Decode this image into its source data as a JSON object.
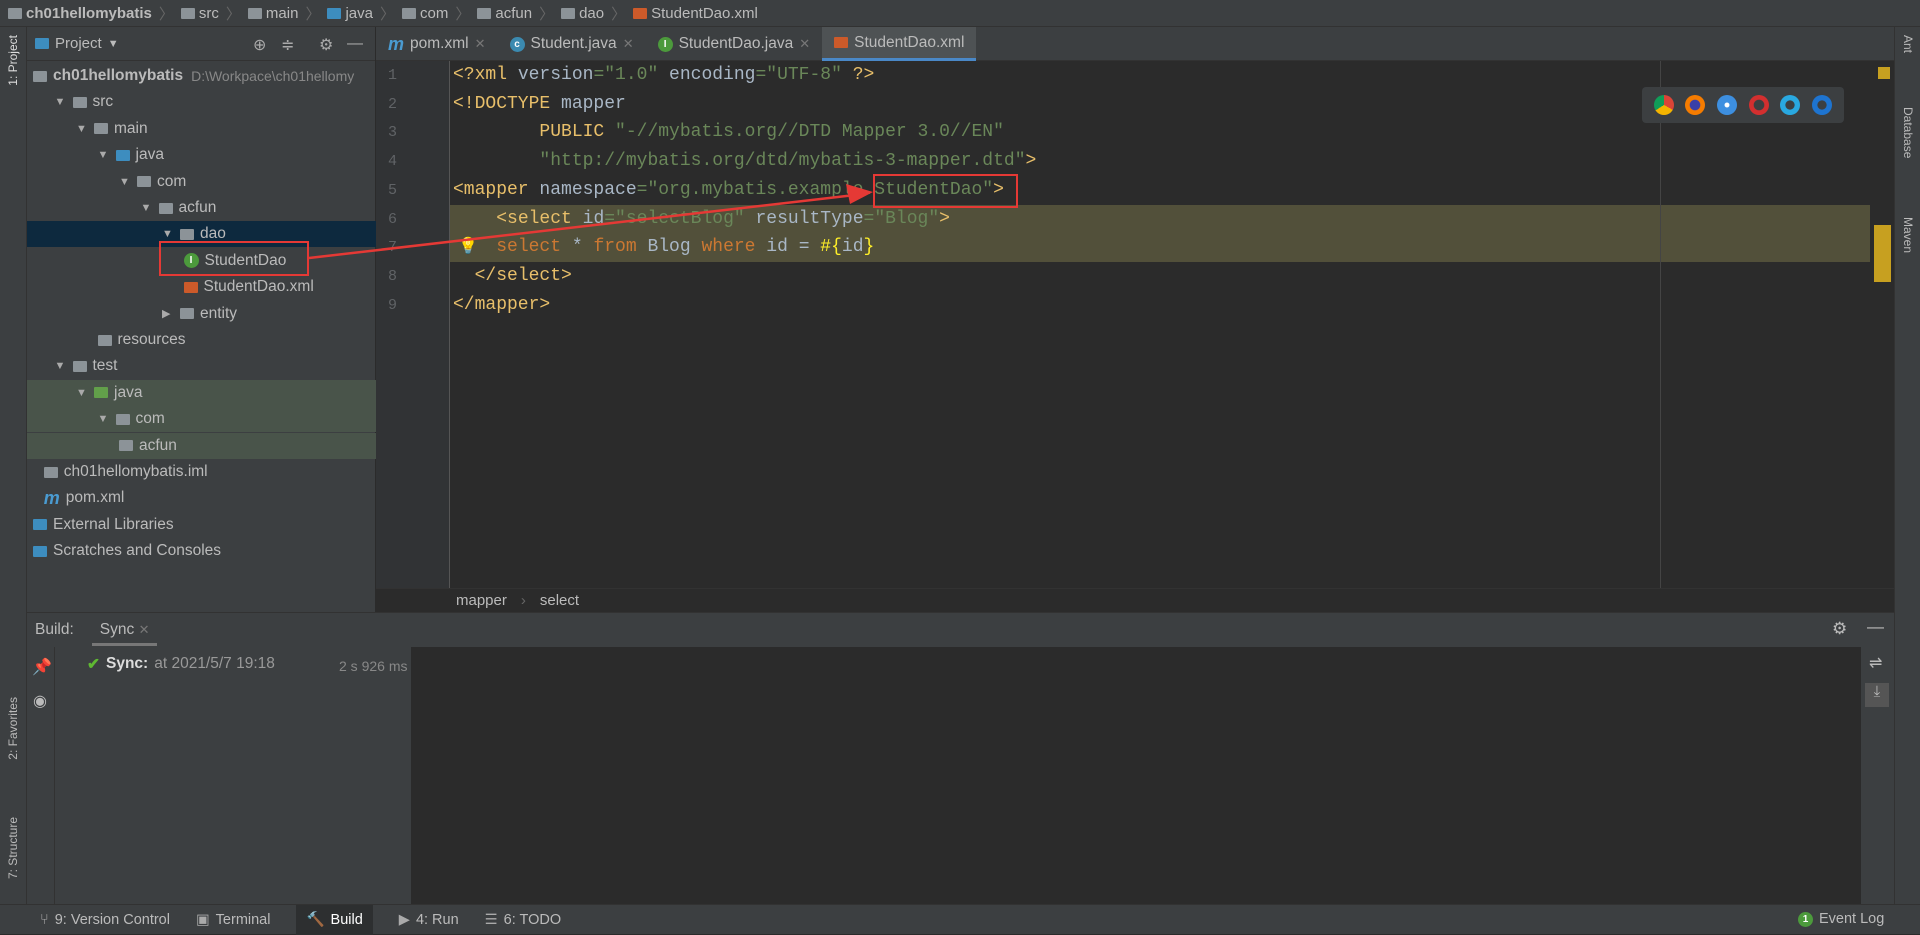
{
  "nav": {
    "crumbs": [
      "ch01hellomybatis",
      "src",
      "main",
      "java",
      "com",
      "acfun",
      "dao",
      "StudentDao.xml"
    ]
  },
  "left_strip": {
    "project": "1: Project",
    "favorites": "2: Favorites",
    "structure": "7: Structure"
  },
  "right_strip": {
    "ant": "Ant",
    "database": "Database",
    "maven": "Maven"
  },
  "project": {
    "title": "Project",
    "tree": [
      {
        "label": "ch01hellomybatis",
        "path": "D:\\Workpace\\ch01hellomy",
        "level": 0,
        "arrow": "",
        "icon": "module"
      },
      {
        "label": "src",
        "level": 1,
        "arrow": "▼",
        "icon": "folder"
      },
      {
        "label": "main",
        "level": 2,
        "arrow": "▼",
        "icon": "folder"
      },
      {
        "label": "java",
        "level": 3,
        "arrow": "▼",
        "icon": "folder-blue"
      },
      {
        "label": "com",
        "level": 4,
        "arrow": "▼",
        "icon": "package"
      },
      {
        "label": "acfun",
        "level": 5,
        "arrow": "▼",
        "icon": "package"
      },
      {
        "label": "dao",
        "level": 6,
        "arrow": "▼",
        "icon": "package",
        "selected": true
      },
      {
        "label": "StudentDao",
        "level": 7,
        "arrow": "",
        "icon": "interface"
      },
      {
        "label": "StudentDao.xml",
        "level": 7,
        "arrow": "",
        "icon": "xml"
      },
      {
        "label": "entity",
        "level": 6,
        "arrow": "▶",
        "icon": "package"
      },
      {
        "label": "resources",
        "level": 3,
        "arrow": "",
        "icon": "resources"
      },
      {
        "label": "test",
        "level": 1,
        "arrow": "▼",
        "icon": "folder"
      },
      {
        "label": "java",
        "level": 2,
        "arrow": "▼",
        "icon": "folder-green",
        "test": true
      },
      {
        "label": "com",
        "level": 3,
        "arrow": "▼",
        "icon": "package",
        "test": true
      },
      {
        "label": "acfun",
        "level": 4,
        "arrow": "",
        "icon": "package",
        "test": true
      },
      {
        "label": "ch01hellomybatis.iml",
        "level": 0.5,
        "arrow": "",
        "icon": "iml"
      },
      {
        "label": "pom.xml",
        "level": 0.5,
        "arrow": "",
        "icon": "maven"
      },
      {
        "label": "External Libraries",
        "level": 0,
        "arrow": "",
        "icon": "libraries"
      },
      {
        "label": "Scratches and Consoles",
        "level": 0,
        "arrow": "",
        "icon": "scratches"
      }
    ]
  },
  "tabs": [
    {
      "label": "pom.xml",
      "icon": "maven",
      "active": false
    },
    {
      "label": "Student.java",
      "icon": "class",
      "active": false
    },
    {
      "label": "StudentDao.java",
      "icon": "interface",
      "active": false
    },
    {
      "label": "StudentDao.xml",
      "icon": "xml",
      "active": true
    }
  ],
  "editor": {
    "line_numbers": [
      "1",
      "2",
      "3",
      "4",
      "5",
      "6",
      "7",
      "8",
      "9"
    ],
    "lines": [
      [
        [
          "t",
          "<?xml "
        ],
        [
          "",
          "version"
        ],
        [
          "s",
          "=\"1.0\""
        ],
        [
          "",
          " encoding"
        ],
        [
          "s",
          "=\"UTF-8\""
        ],
        [
          "t",
          " ?>"
        ]
      ],
      [
        [
          "t",
          "<!DOCTYPE "
        ],
        [
          "",
          "mapper"
        ]
      ],
      [
        [
          "",
          "        "
        ],
        [
          "t",
          "PUBLIC "
        ],
        [
          "s",
          "\"-//mybatis.org//DTD Mapper 3.0//EN\""
        ]
      ],
      [
        [
          "",
          "        "
        ],
        [
          "s",
          "\"http://mybatis.org/dtd/mybatis-3-mapper.dtd\""
        ],
        [
          "t",
          ">"
        ]
      ],
      [
        [
          "t",
          "<mapper "
        ],
        [
          "",
          "namespace"
        ],
        [
          "s",
          "=\"org.mybatis.example.StudentDao\""
        ],
        [
          "t",
          ">"
        ]
      ],
      [
        [
          "",
          "    "
        ],
        [
          "t",
          "<select "
        ],
        [
          "",
          "id"
        ],
        [
          "s",
          "=\"selectBlog\""
        ],
        [
          "",
          " resultType"
        ],
        [
          "s",
          "=\"Blog\""
        ],
        [
          "t",
          ">"
        ]
      ],
      [
        [
          "",
          "    "
        ],
        [
          "k",
          "select"
        ],
        [
          "",
          " * "
        ],
        [
          "k",
          "from"
        ],
        [
          "",
          " Blog "
        ],
        [
          "k",
          "where"
        ],
        [
          "",
          " id = "
        ],
        [
          "y",
          "#{"
        ],
        [
          "",
          "id"
        ],
        [
          "y",
          "}"
        ]
      ],
      [
        [
          "",
          "  "
        ],
        [
          "t",
          "</select>"
        ]
      ],
      [
        [
          "t",
          "</mapper>"
        ]
      ]
    ],
    "breadcrumb": [
      "mapper",
      "select"
    ],
    "browsers": [
      "chrome",
      "firefox",
      "safari",
      "opera",
      "internet-explorer",
      "edge"
    ]
  },
  "build": {
    "label": "Build:",
    "tab": "Sync",
    "sync_label": "Sync:",
    "sync_time": "at 2021/5/7 19:18",
    "duration": "2 s 926 ms"
  },
  "status": {
    "items": [
      "9: Version Control",
      "Terminal",
      "Build",
      "4: Run",
      "6: TODO"
    ],
    "event_log": "Event Log",
    "event_count": "1"
  },
  "colors": {
    "accent": "#4a88c7",
    "annotation": "#e53935"
  }
}
